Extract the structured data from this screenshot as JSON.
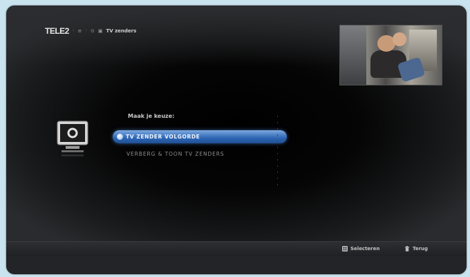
{
  "header": {
    "logo": "TELE2",
    "breadcrumb": [
      "≡",
      "⊙",
      "▣",
      "TV zenders"
    ]
  },
  "menu": {
    "title": "Maak je keuze:",
    "items": [
      {
        "label": "TV ZENDER VOLGORDE",
        "selected": true
      },
      {
        "label": "VERBERG & TOON TV ZENDERS",
        "selected": false
      }
    ]
  },
  "footer": {
    "actions": [
      {
        "icon": "grid-icon",
        "label": "Selecteren"
      },
      {
        "icon": "trash-icon",
        "label": "Terug"
      }
    ]
  },
  "colors": {
    "page_bg": "#c9e3ef",
    "highlight": "#2d66b4"
  }
}
